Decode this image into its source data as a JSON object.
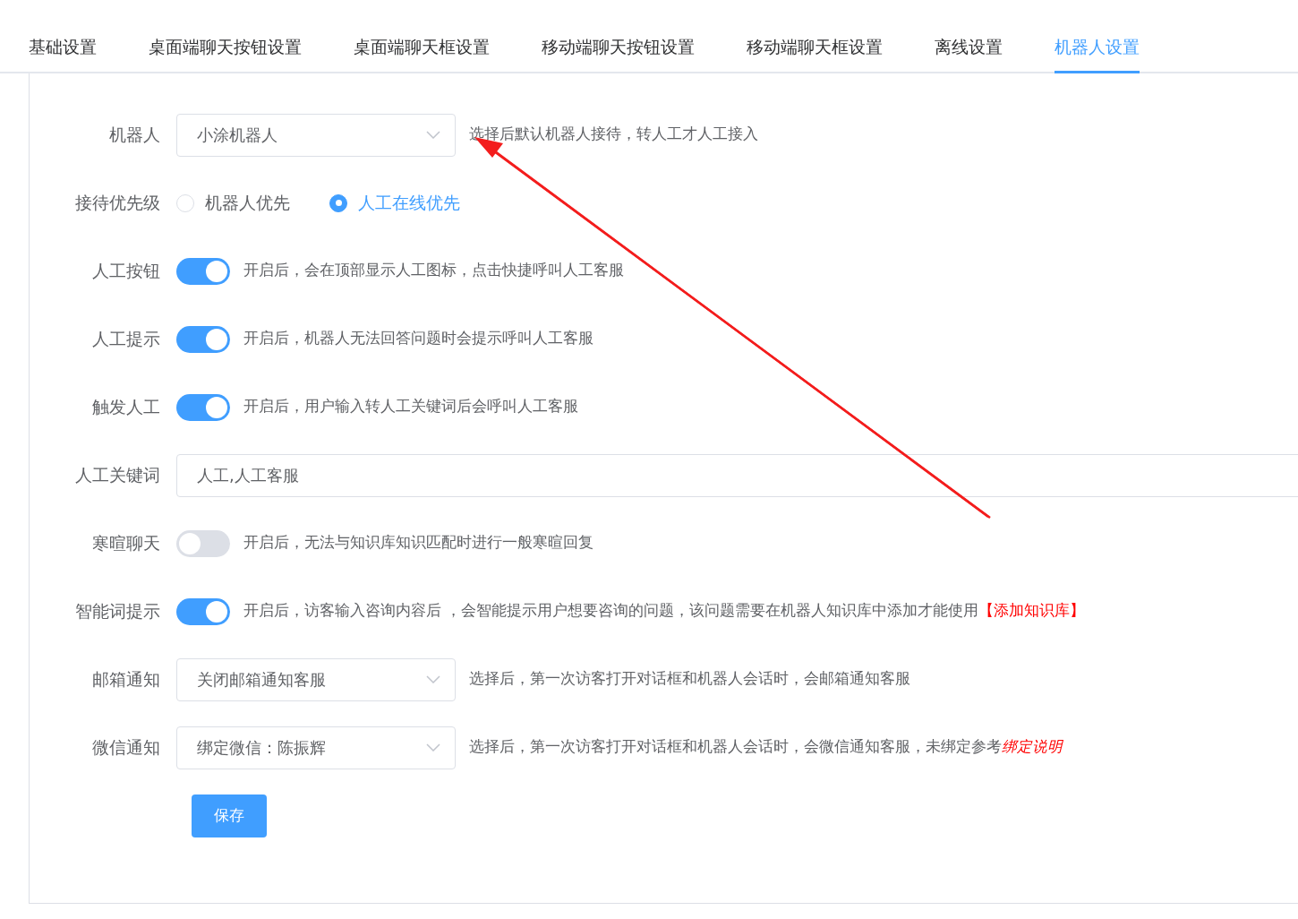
{
  "tabs": [
    {
      "label": "基础设置",
      "selected": false
    },
    {
      "label": "桌面端聊天按钮设置",
      "selected": false
    },
    {
      "label": "桌面端聊天框设置",
      "selected": false
    },
    {
      "label": "移动端聊天按钮设置",
      "selected": false
    },
    {
      "label": "移动端聊天框设置",
      "selected": false
    },
    {
      "label": "离线设置",
      "selected": false
    },
    {
      "label": "机器人设置",
      "selected": true
    }
  ],
  "form": [
    {
      "kind": "select",
      "label": "机器人",
      "value": "小涂机器人",
      "hint": "选择后默认机器人接待，转人工才人工接入"
    },
    {
      "kind": "radio",
      "label": "接待优先级",
      "options": [
        {
          "label": "机器人优先",
          "selected": false
        },
        {
          "label": "人工在线优先",
          "selected": true
        }
      ]
    },
    {
      "kind": "switch",
      "label": "人工按钮",
      "on": true,
      "hint": "开启后，会在顶部显示人工图标，点击快捷呼叫人工客服"
    },
    {
      "kind": "switch",
      "label": "人工提示",
      "on": true,
      "hint": "开启后，机器人无法回答问题时会提示呼叫人工客服"
    },
    {
      "kind": "switch",
      "label": "触发人工",
      "on": true,
      "hint": "开启后，用户输入转人工关键词后会呼叫人工客服"
    },
    {
      "kind": "input",
      "label": "人工关键词",
      "value": "人工,人工客服"
    },
    {
      "kind": "switch",
      "label": "寒暄聊天",
      "on": false,
      "hint": "开启后，无法与知识库知识匹配时进行一般寒暄回复"
    },
    {
      "kind": "switch",
      "label": "智能词提示",
      "on": true,
      "hint": "开启后，访客输入咨询内容后 ，会智能提示用户想要咨询的问题，该问题需要在机器人知识库中添加才能使用",
      "link": {
        "text": "【添加知识库】",
        "italic": false
      }
    },
    {
      "kind": "select",
      "label": "邮箱通知",
      "value": "关闭邮箱通知客服",
      "hint": "选择后，第一次访客打开对话框和机器人会话时，会邮箱通知客服"
    },
    {
      "kind": "select",
      "label": "微信通知",
      "value": "绑定微信：陈振辉",
      "hint": "选择后，第一次访客打开对话框和机器人会话时，会微信通知客服，未绑定参考",
      "link": {
        "text": "绑定说明",
        "italic": true
      }
    }
  ],
  "save_button": "保存"
}
